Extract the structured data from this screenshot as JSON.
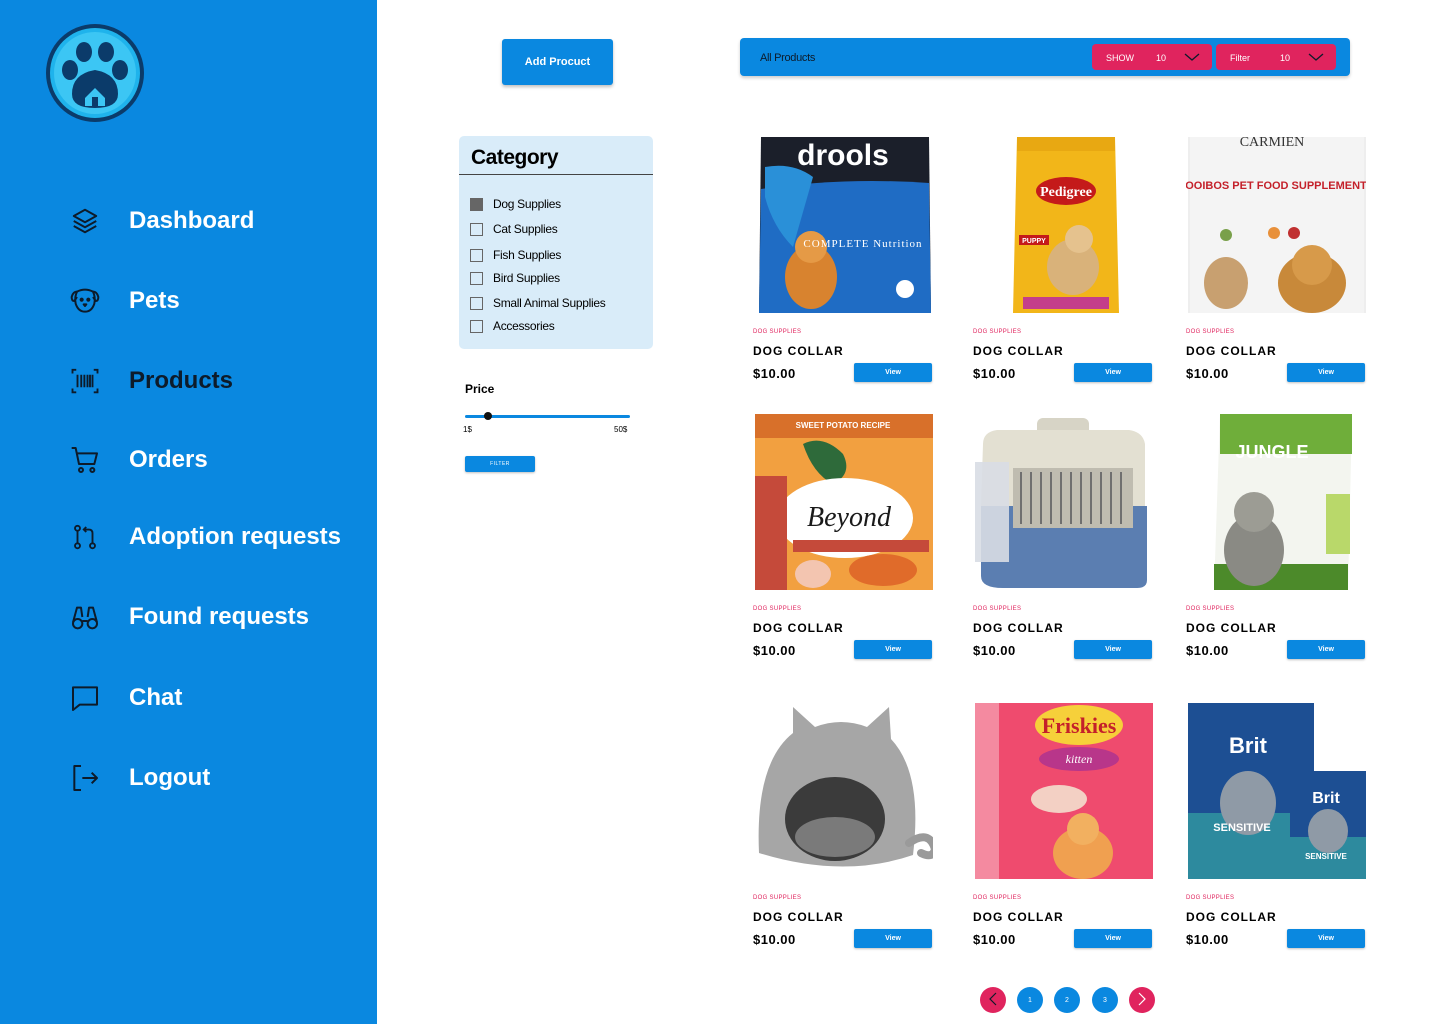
{
  "sidebar": {
    "items": [
      {
        "label": "Dashboard",
        "icon": "layers-icon"
      },
      {
        "label": "Pets",
        "icon": "dog-icon"
      },
      {
        "label": "Products",
        "icon": "barcode-icon"
      },
      {
        "label": "Orders",
        "icon": "cart-icon"
      },
      {
        "label": "Adoption requests",
        "icon": "git-pull-request-icon"
      },
      {
        "label": "Found requests",
        "icon": "binoculars-icon"
      },
      {
        "label": "Chat",
        "icon": "message-square-icon"
      },
      {
        "label": "Logout",
        "icon": "logout-icon"
      }
    ],
    "active": "Products"
  },
  "toolbar": {
    "add_label": "Add Procuct",
    "title": "All Products",
    "show_label": "SHOW",
    "show_value": "10",
    "filter_label": "Filter",
    "filter_value": "10"
  },
  "category": {
    "title": "Category",
    "items": [
      {
        "label": "Dog Supplies",
        "checked": true
      },
      {
        "label": "Cat Supplies",
        "checked": false
      },
      {
        "label": "Fish Supplies",
        "checked": false
      },
      {
        "label": "Bird Supplies",
        "checked": false
      },
      {
        "label": "Small Animal Supplies",
        "checked": false
      },
      {
        "label": "Accessories",
        "checked": false
      }
    ]
  },
  "price": {
    "title": "Price",
    "min_label": "1$",
    "max_label": "50$",
    "filter_label": "FILTER"
  },
  "products": [
    {
      "category": "DOG SUPPLIES",
      "name": "DOG COLLAR",
      "price": "$10.00",
      "view": "View",
      "image_label": "drools",
      "image_sub": "COMPLETE Nutrition"
    },
    {
      "category": "DOG SUPPLIES",
      "name": "DOG COLLAR",
      "price": "$10.00",
      "view": "View",
      "image_label": "Pedigree",
      "image_sub": "PUPPY"
    },
    {
      "category": "DOG SUPPLIES",
      "name": "DOG COLLAR",
      "price": "$10.00",
      "view": "View",
      "image_label": "CARMIEN",
      "image_sub": "ROOIBOS PET FOOD SUPPLEMENT"
    },
    {
      "category": "DOG SUPPLIES",
      "name": "DOG COLLAR",
      "price": "$10.00",
      "view": "View",
      "image_label": "Beyond",
      "image_sub": "SWEET POTATO RECIPE"
    },
    {
      "category": "DOG SUPPLIES",
      "name": "DOG COLLAR",
      "price": "$10.00",
      "view": "View",
      "image_label": "",
      "image_sub": ""
    },
    {
      "category": "DOG SUPPLIES",
      "name": "DOG COLLAR",
      "price": "$10.00",
      "view": "View",
      "image_label": "JUNGLE",
      "image_sub": ""
    },
    {
      "category": "DOG SUPPLIES",
      "name": "DOG COLLAR",
      "price": "$10.00",
      "view": "View",
      "image_label": "",
      "image_sub": ""
    },
    {
      "category": "DOG SUPPLIES",
      "name": "DOG COLLAR",
      "price": "$10.00",
      "view": "View",
      "image_label": "Friskies",
      "image_sub": "kitten"
    },
    {
      "category": "DOG SUPPLIES",
      "name": "DOG COLLAR",
      "price": "$10.00",
      "view": "View",
      "image_label": "Brit",
      "image_sub": "SENSITIVE"
    }
  ],
  "pagination": {
    "pages": [
      "1",
      "2",
      "3"
    ],
    "prev_icon": "chevron-left-icon",
    "next_icon": "chevron-right-icon"
  },
  "colors": {
    "primary": "#0A88E0",
    "accent": "#E0245E",
    "category_bg": "#D9ECF9"
  }
}
